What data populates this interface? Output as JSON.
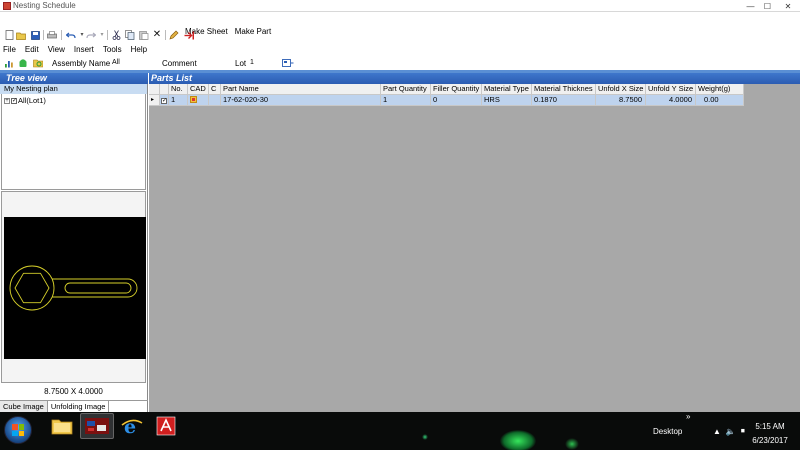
{
  "window": {
    "title": "Nesting Schedule",
    "controls": {
      "minimize": "—",
      "maximize": "☐",
      "close": "✕"
    }
  },
  "top_menu": {
    "make_sheet": "Make Sheet",
    "make_part": "Make Part"
  },
  "menubar": [
    "File",
    "Edit",
    "View",
    "Insert",
    "Tools",
    "Help"
  ],
  "toolbar2": {
    "assembly_label": "Assembly Name",
    "assembly_value": "All",
    "comment_label": "Comment",
    "comment_value": "",
    "lot_label": "Lot",
    "lot_value": "1"
  },
  "tree": {
    "header": "Tree view",
    "root": "My Nesting plan",
    "node": "All(Lot1)",
    "expander": "+",
    "check": "✓"
  },
  "preview": {
    "dimension": "8.7500 X 4.0000",
    "tabs": [
      "Cube Image",
      "Unfolding Image"
    ],
    "active_tab": 1,
    "stroke_color": "#d6cf2a"
  },
  "parts_list": {
    "header": "Parts List",
    "columns": [
      "",
      "",
      "No.",
      "CAD",
      "C",
      "Part Name",
      "Part Quantity",
      "Filler Quantity",
      "Material Type",
      "Material Thicknes",
      "Unfold X Size",
      "Unfold Y Size",
      "Weight(g)"
    ],
    "rows": [
      {
        "marker": "▸",
        "check": "✓",
        "no": "1",
        "cad": "",
        "c": "",
        "part_name": "17-62-020-30",
        "part_qty": "1",
        "filler_qty": "0",
        "material_type": "HRS",
        "thickness": "0.1870",
        "unfold_x": "8.7500",
        "unfold_y": "4.0000",
        "weight": "0.00"
      }
    ]
  },
  "taskbar": {
    "desktop_label": "Desktop",
    "chevron": "»",
    "tray": [
      "▲",
      "🔈",
      "⏹"
    ],
    "time": "5:15 AM",
    "date": "6/23/2017"
  },
  "colors": {
    "panel_header": "#2f63bb",
    "tree_root_bg": "#c8dcf2",
    "selected_row": "#bed3ee",
    "grid_bg": "#a8a8a8",
    "taskbar": "#090b0a"
  }
}
